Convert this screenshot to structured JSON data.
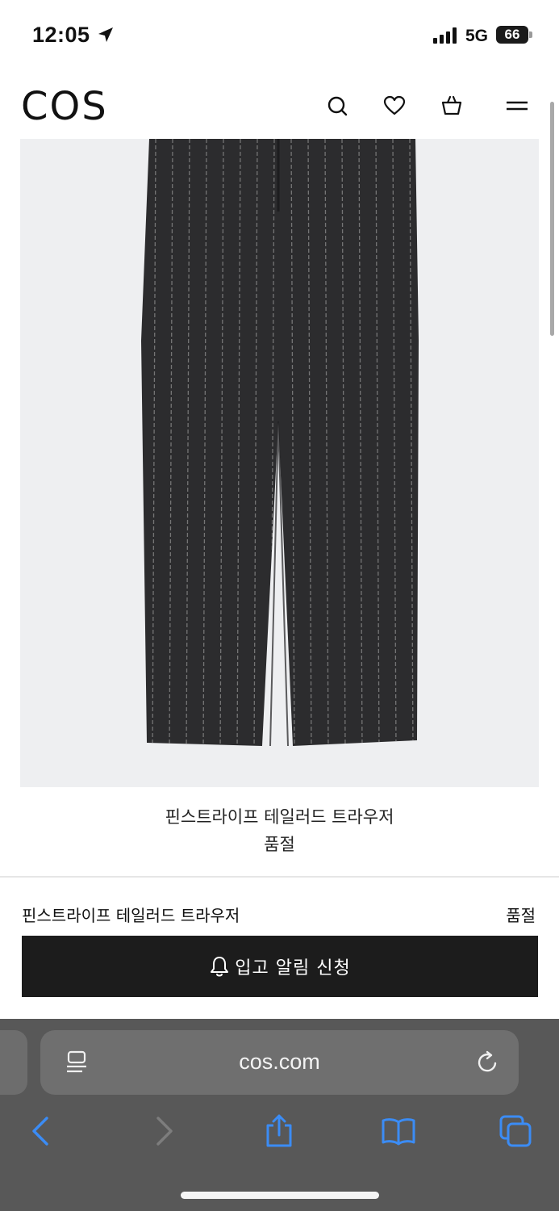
{
  "status_bar": {
    "time": "12:05",
    "network": "5G",
    "battery": "66"
  },
  "header": {
    "logo": "COS"
  },
  "product": {
    "image_colors": {
      "background": "#eeeff1",
      "fabric": "#2c2c2e",
      "stripe": "#8e8e8e"
    },
    "title": "핀스트라이프 테일러드 트라우저",
    "status": "품절"
  },
  "sticky_bar": {
    "name": "핀스트라이프 테일러드 트라우저",
    "status": "품절",
    "notify_label": "입고 알림 신청"
  },
  "browser": {
    "url": "cos.com"
  }
}
